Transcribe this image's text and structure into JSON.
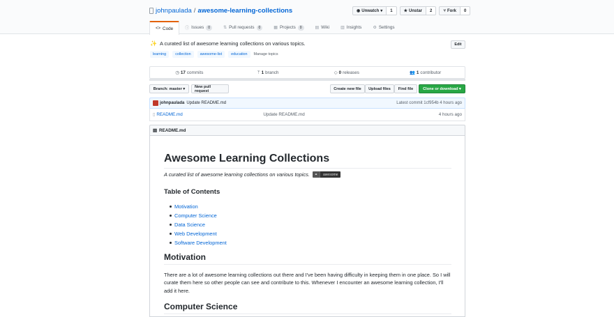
{
  "repo": {
    "owner": "johnpaulada",
    "separator": "/",
    "name": "awesome-learning-collections"
  },
  "actions": [
    {
      "icon": "eye-icon",
      "label": "Unwatch",
      "count": "1"
    },
    {
      "icon": "star-icon",
      "label": "Unstar",
      "count": "2"
    },
    {
      "icon": "fork-icon",
      "label": "Fork",
      "count": "0"
    }
  ],
  "tabs": [
    {
      "label": "Code",
      "icon": "code-icon",
      "active": true
    },
    {
      "label": "Issues",
      "count": "0",
      "icon": "issue-icon"
    },
    {
      "label": "Pull requests",
      "count": "0",
      "icon": "pull-request-icon"
    },
    {
      "label": "Projects",
      "count": "0",
      "icon": "project-icon"
    },
    {
      "label": "Wiki",
      "icon": "book-icon"
    },
    {
      "label": "Insights",
      "icon": "graph-icon"
    },
    {
      "label": "Settings",
      "icon": "gear-icon"
    }
  ],
  "description": "A curated list of awesome learning collections on various topics.",
  "edit_label": "Edit",
  "topics": [
    "learning",
    "collection",
    "awesome-list",
    "education"
  ],
  "manage_topics": "Manage topics",
  "stats": {
    "commits_count": "17",
    "commits_label": "commits",
    "branch_count": "1",
    "branch_label": "branch",
    "releases_count": "0",
    "releases_label": "releases",
    "contributor_count": "1",
    "contributor_label": "contributor"
  },
  "toolbar": {
    "branch_label": "Branch: master",
    "new_pr": "New pull request",
    "create_file": "Create new file",
    "upload_files": "Upload files",
    "find_file": "Find file",
    "clone": "Clone or download"
  },
  "commit": {
    "user": "johnpaulada",
    "message": "Update README.md",
    "latest_label": "Latest commit",
    "sha": "1cf954b",
    "age": "4 hours ago"
  },
  "files": [
    {
      "name": "README.md",
      "message": "Update README.md",
      "age": "4 hours ago"
    }
  ],
  "readme": {
    "header": "README.md",
    "title": "Awesome Learning Collections",
    "subtitle": "A curated list of awesome learning collections on various topics.",
    "badge_right": "awesome",
    "toc_title": "Table of Contents",
    "toc": [
      "Motivation",
      "Computer Science",
      "Data Science",
      "Web Development",
      "Software Development"
    ],
    "motivation_heading": "Motivation",
    "motivation_text": "There are a lot of awesome learning collections out there and I've been having difficulty in keeping them in one place. So I will curate them here so other people can see and contribute to this. Whenever I encounter an awesome learning collection, I'll add it here.",
    "next_heading": "Computer Science"
  },
  "colors": {
    "accent": "#e36209",
    "link": "#0366d6",
    "green": "#28a745"
  }
}
